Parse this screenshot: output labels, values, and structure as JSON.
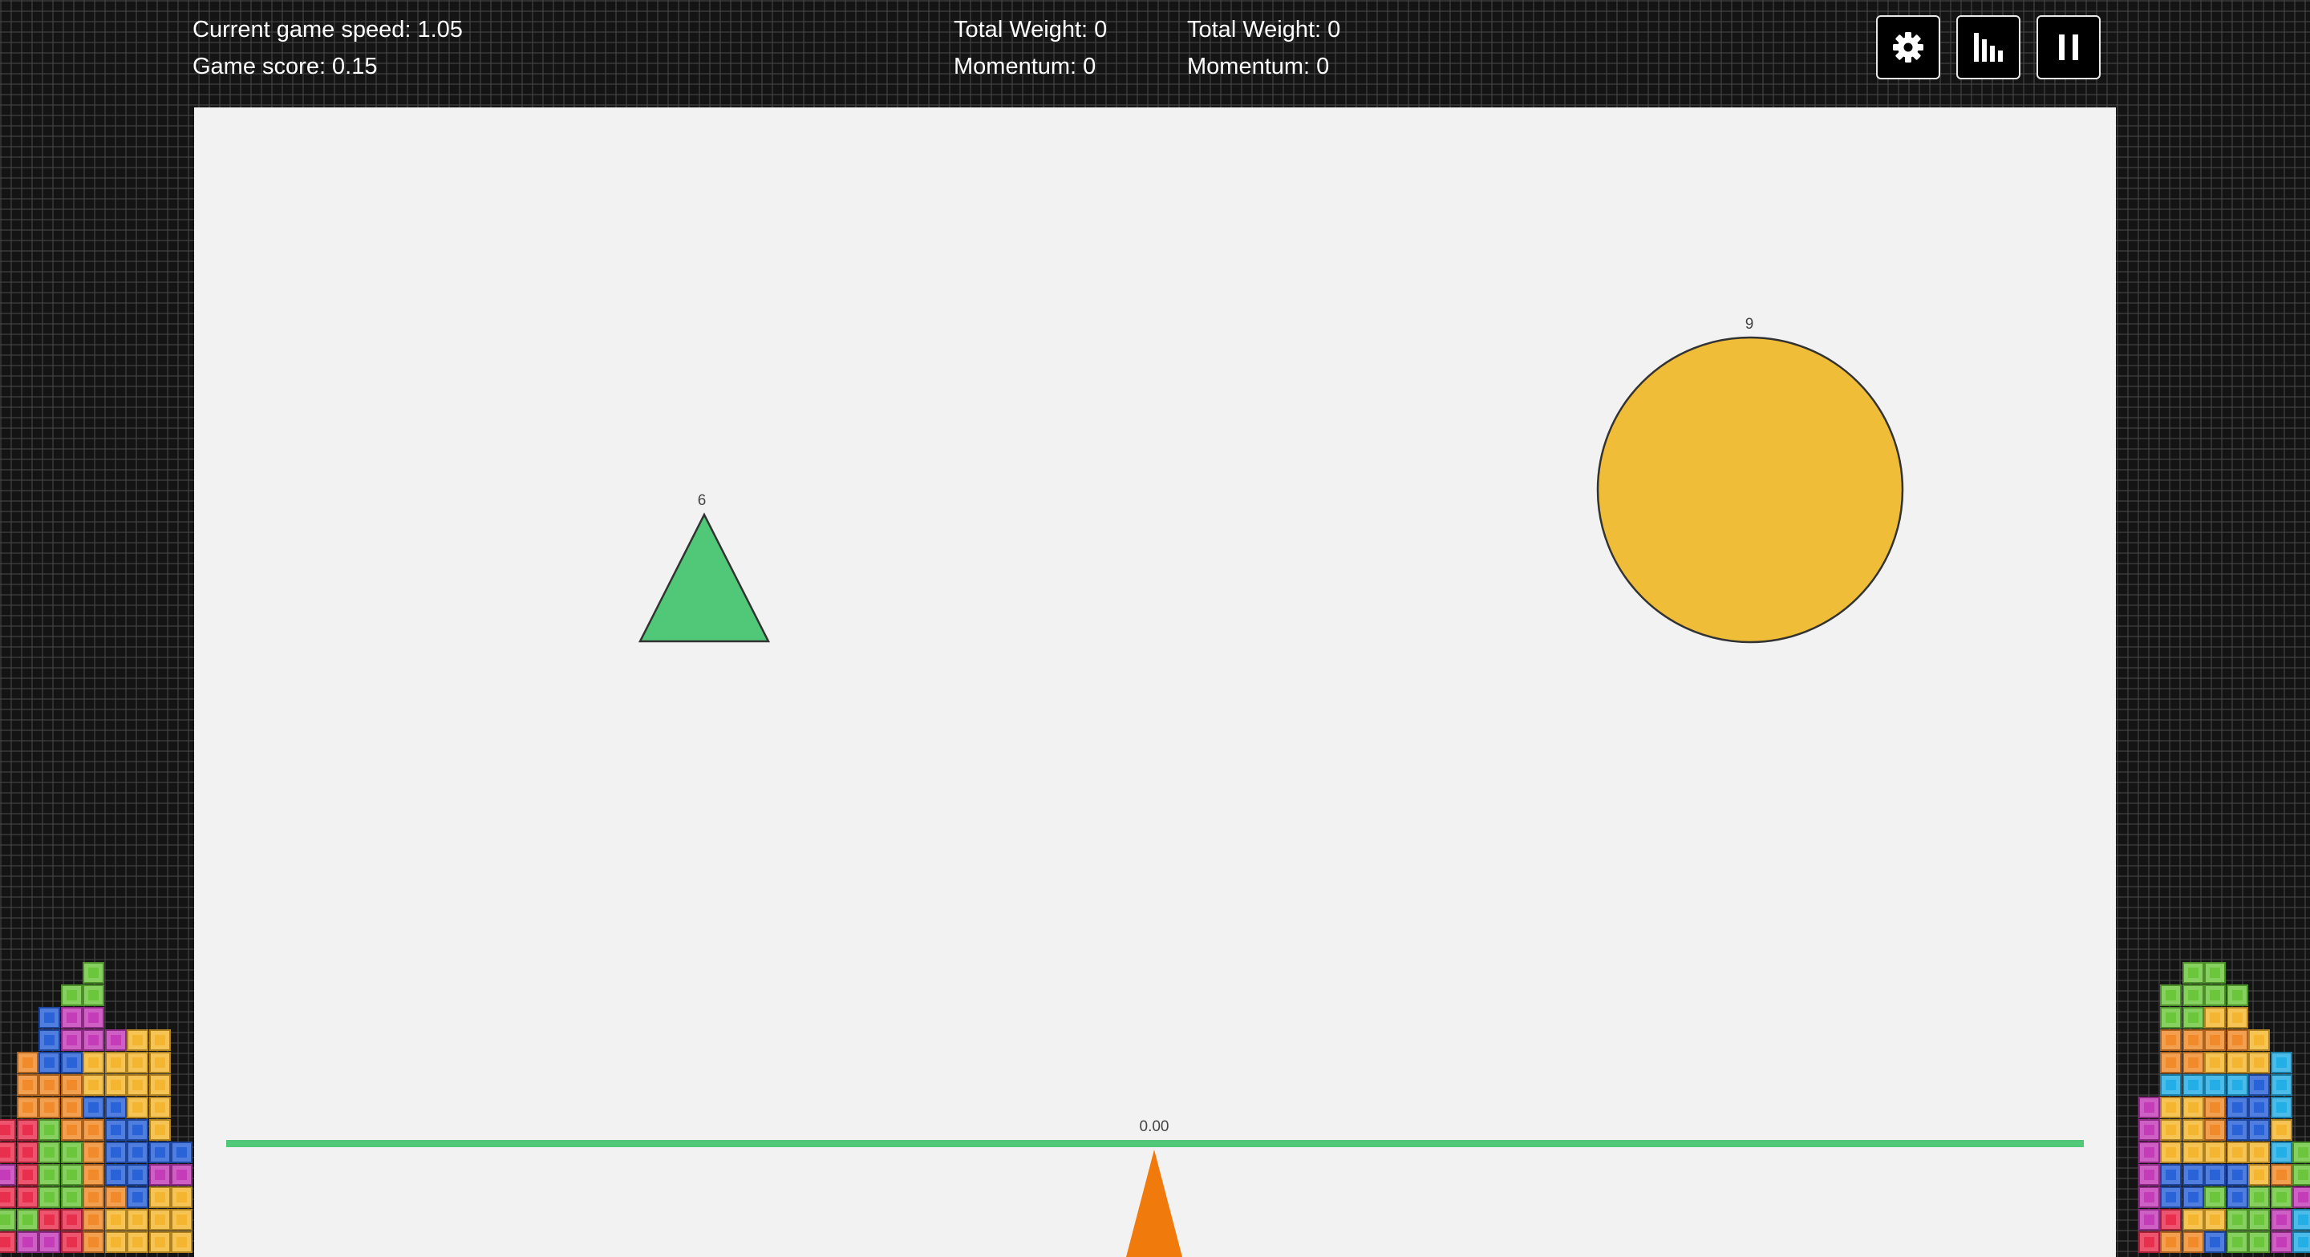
{
  "hud": {
    "game_speed": "Current game speed: 1.05",
    "game_score": "Game score: 0.15",
    "left_side": {
      "total_weight": "Total Weight: 0",
      "momentum": "Momentum: 0"
    },
    "right_side": {
      "total_weight": "Total Weight: 0",
      "momentum": "Momentum: 0"
    }
  },
  "controls": [
    {
      "name": "settings-button",
      "icon": "gear-icon"
    },
    {
      "name": "stats-button",
      "icon": "bar-chart-icon"
    },
    {
      "name": "pause-button",
      "icon": "pause-icon"
    }
  ],
  "objects": {
    "triangle": {
      "weight_label": "6",
      "color": "#50c878"
    },
    "circle": {
      "weight_label": "9",
      "color": "#f0bd38"
    }
  },
  "seesaw": {
    "angle_label": "0.00",
    "beam_color": "#50c878",
    "fulcrum_color": "#f07a0c"
  },
  "tile_colors": {
    "r": "#e8304e",
    "m": "#c43cb8",
    "o": "#f08a2a",
    "y": "#f4b630",
    "g": "#6cc63c",
    "b": "#2a62d8",
    "c": "#24aee6"
  }
}
